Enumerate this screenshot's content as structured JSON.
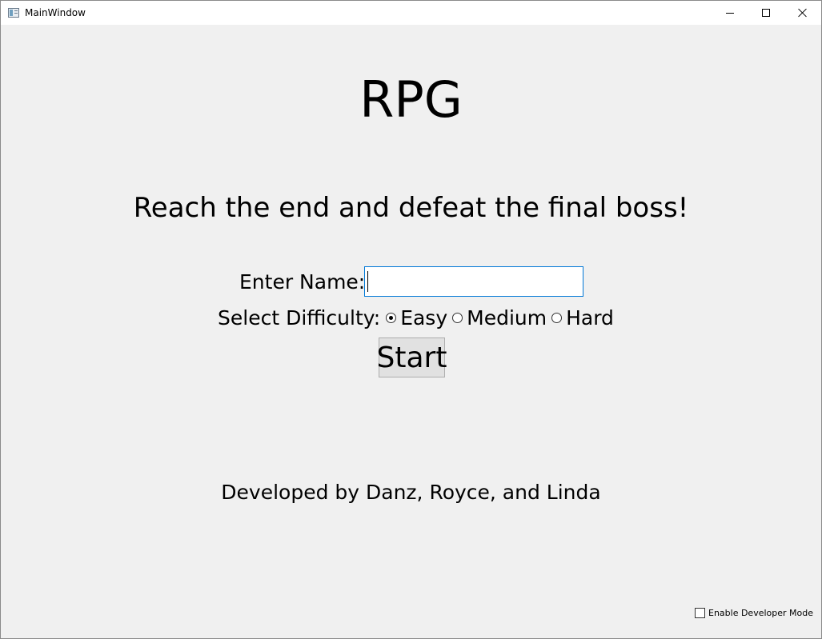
{
  "window": {
    "title": "MainWindow"
  },
  "main": {
    "title": "RPG",
    "subtitle": "Reach the end and defeat the final boss!",
    "name_label": "Enter Name:",
    "name_value": "",
    "difficulty_label": "Select Difficulty:",
    "difficulty_options": [
      {
        "label": "Easy",
        "checked": true
      },
      {
        "label": "Medium",
        "checked": false
      },
      {
        "label": "Hard",
        "checked": false
      }
    ],
    "start_label": "Start",
    "credits": "Developed by Danz, Royce, and Linda",
    "dev_mode_label": "Enable Developer Mode",
    "dev_mode_checked": false
  },
  "colors": {
    "background": "#f0f0f0",
    "focus_border": "#0078d7",
    "button_bg": "#e1e1e1"
  }
}
